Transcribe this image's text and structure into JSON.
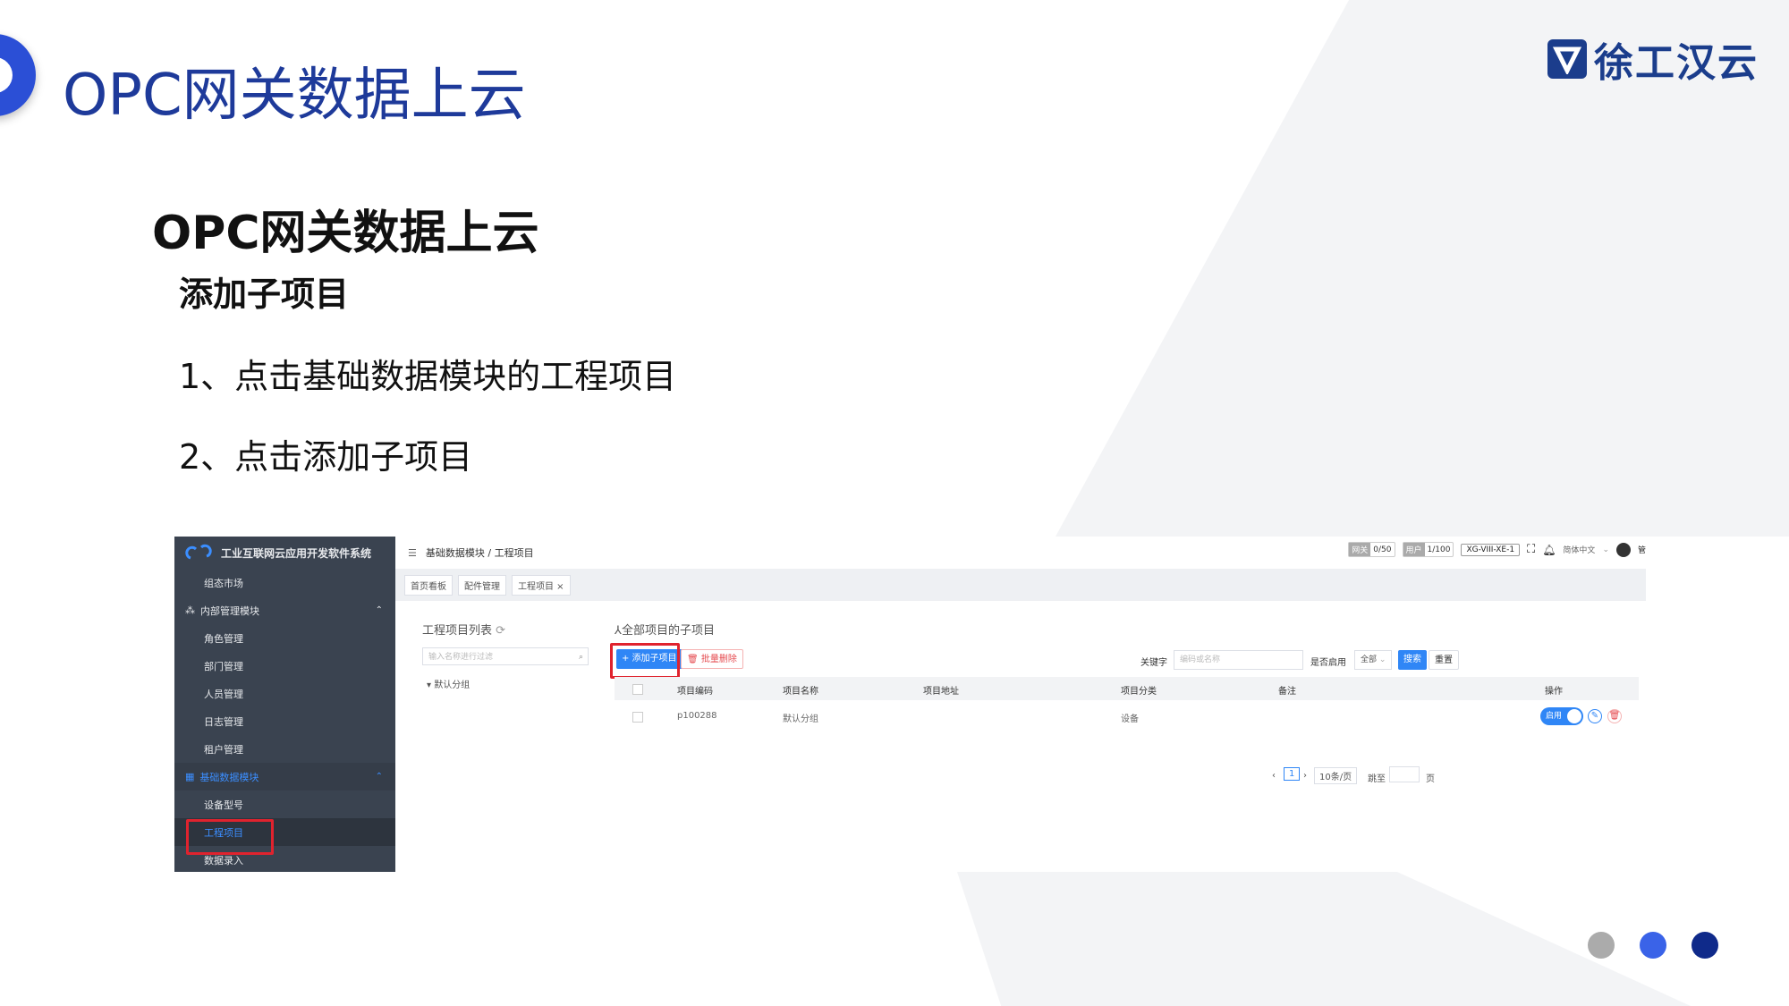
{
  "slide": {
    "title": "OPC网关数据上云",
    "logo_text": "徐工汉云",
    "heading": "OPC网关数据上云",
    "subheading": "添加子项目",
    "steps": [
      "1、点击基础数据模块的工程项目",
      "2、点击添加子项目"
    ],
    "dot_colors": [
      "#ababab",
      "#3a63e8",
      "#0f2a8a"
    ]
  },
  "app": {
    "brand": "工业互联网云应用开发软件系统",
    "sidebar": {
      "items": [
        {
          "label": "组态市场"
        },
        {
          "label": "内部管理模块"
        },
        {
          "label": "角色管理"
        },
        {
          "label": "部门管理"
        },
        {
          "label": "人员管理"
        },
        {
          "label": "日志管理"
        },
        {
          "label": "租户管理"
        },
        {
          "label": "基础数据模块"
        },
        {
          "label": "设备型号"
        },
        {
          "label": "工程项目"
        },
        {
          "label": "数据录入"
        }
      ]
    },
    "breadcrumb": "基础数据模块 / 工程项目",
    "top": {
      "gateway_key": "网关",
      "gateway_val": "0/50",
      "user_key": "用户",
      "user_val": "1/100",
      "device_tag": "XG-VIII-XE-1",
      "lang": "简体中文",
      "user": "管"
    },
    "tabs": [
      "首页看板",
      "配件管理",
      "工程项目 ×"
    ],
    "tree": {
      "title": "工程项目列表",
      "search_placeholder": "输入名称进行过滤",
      "node": "默认分组"
    },
    "panel": {
      "title": "全部项目的子项目",
      "add_button": "+ 添加子项目",
      "delete_button": "批量删除",
      "keyword_label": "关键字",
      "keyword_placeholder": "编码或名称",
      "enabled_label": "是否启用",
      "enabled_value": "全部",
      "search_button": "搜索",
      "reset_button": "重置"
    },
    "table": {
      "headers": [
        "项目编码",
        "项目名称",
        "项目地址",
        "项目分类",
        "备注",
        "操作"
      ],
      "rows": [
        {
          "code": "p100288",
          "name": "默认分组",
          "address": "",
          "category": "设备",
          "note": "",
          "toggle": "启用"
        }
      ]
    },
    "pager": {
      "page": "1",
      "page_size": "10条/页",
      "goto_label": "跳至",
      "page_unit": "页"
    }
  }
}
